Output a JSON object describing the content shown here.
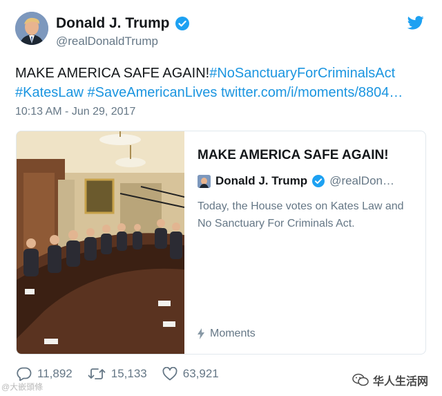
{
  "tweet": {
    "display_name": "Donald J. Trump",
    "handle": "@realDonaldTrump",
    "text_main": "MAKE AMERICA SAFE AGAIN!",
    "hashtag_1": "#NoSanctuaryForCriminalsAct",
    "hashtag_2": "#KatesLaw",
    "hashtag_3": "#SaveAmericanLives",
    "link": "twitter.com/i/moments/8804…",
    "timestamp": "10:13 AM - Jun 29, 2017"
  },
  "card": {
    "title": "MAKE AMERICA SAFE AGAIN!",
    "author_name": "Donald J. Trump",
    "author_handle": "@realDon…",
    "description": "Today, the House votes on Kates Law and No Sanctuary For Criminals Act.",
    "footer": "Moments"
  },
  "actions": {
    "replies": "11,892",
    "retweets": "15,133",
    "likes": "63,921"
  },
  "watermark": {
    "left": "@大嵌頭條",
    "right": "华人生活网"
  },
  "colors": {
    "twitter_blue": "#1da1f2",
    "link_blue": "#1b95e0",
    "muted_gray": "#657786"
  },
  "icons": [
    "verified-badge-icon",
    "twitter-bird-icon",
    "moments-bolt-icon",
    "reply-icon",
    "retweet-icon",
    "like-icon",
    "wechat-icon"
  ]
}
